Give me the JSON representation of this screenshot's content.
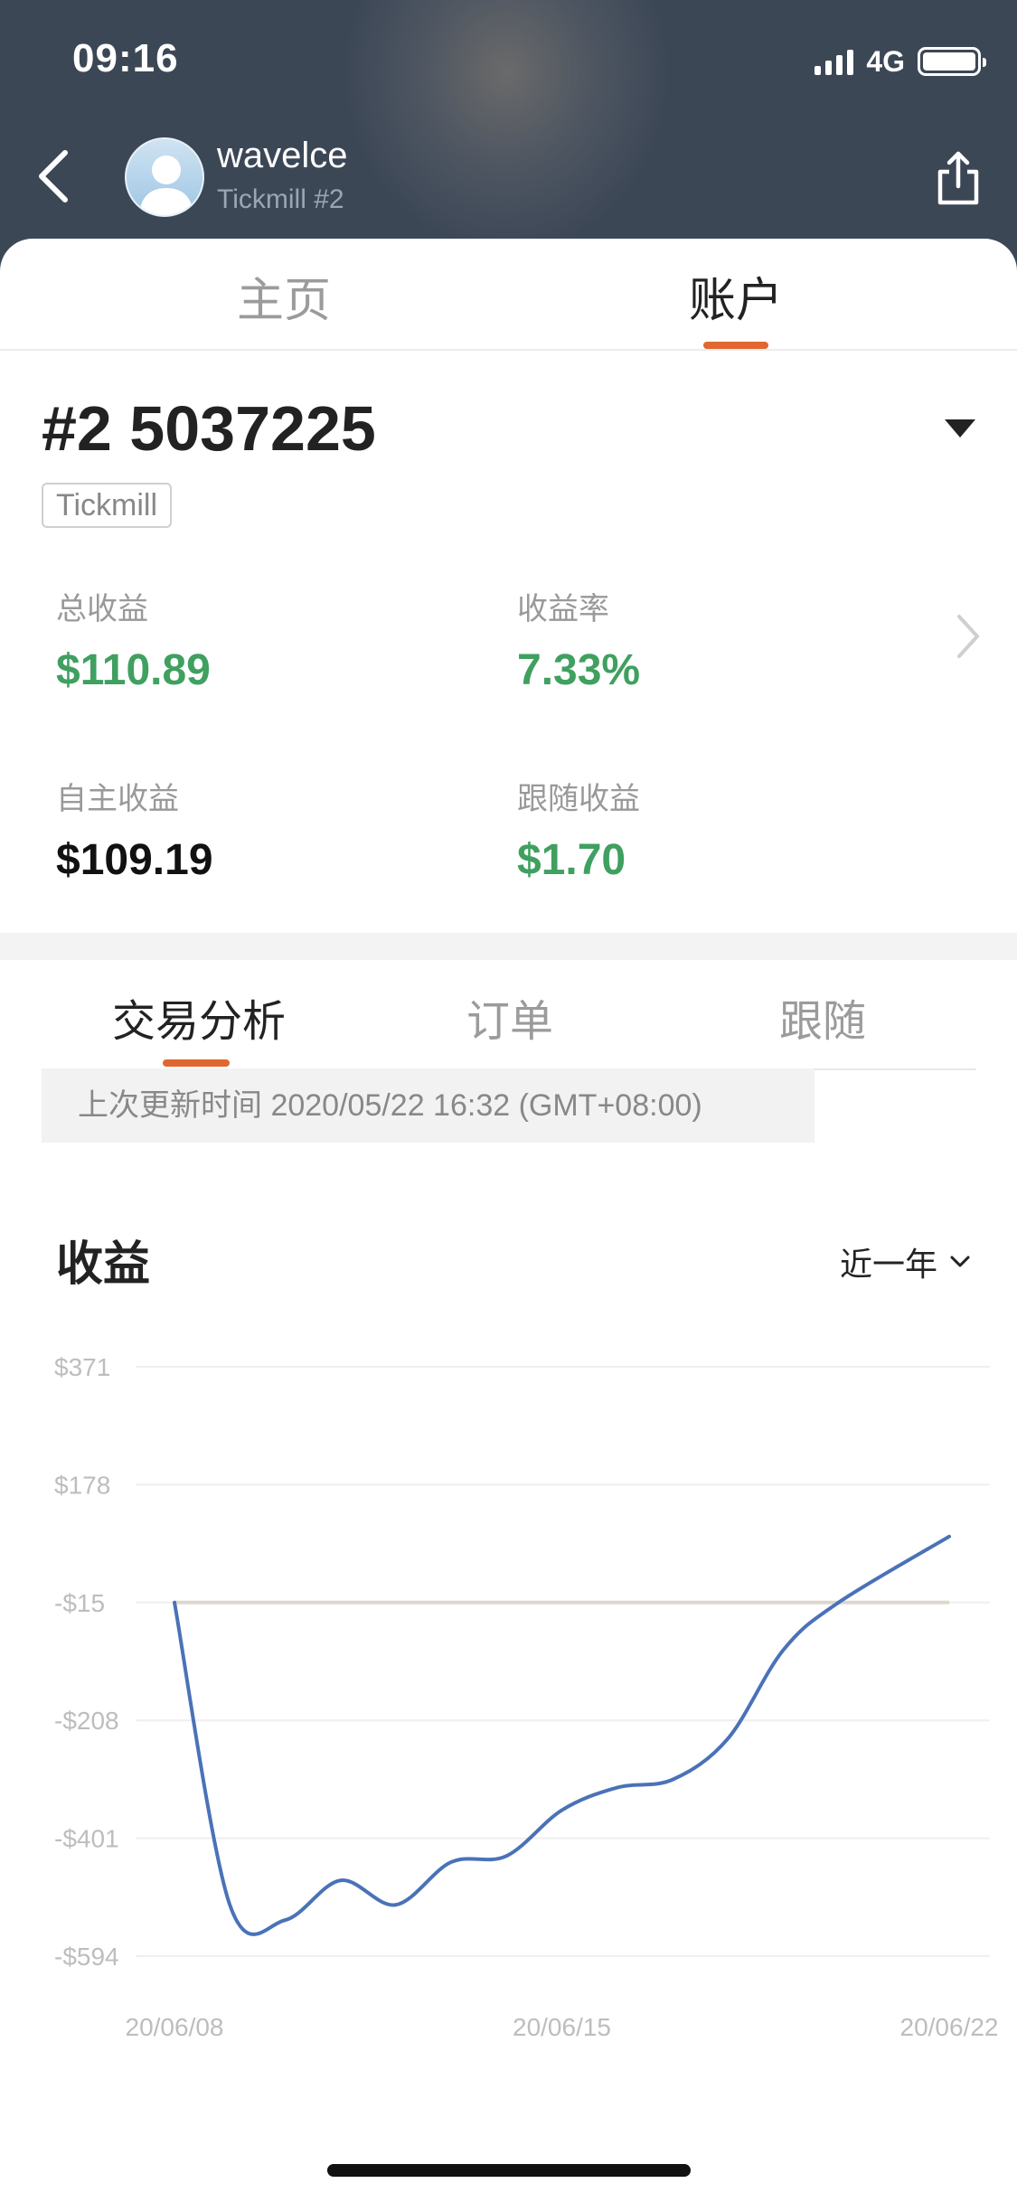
{
  "status_bar": {
    "time": "09:16",
    "network": "4G",
    "battery_level": 1.0
  },
  "header": {
    "back_icon": "chevron-left-icon",
    "user_name": "wavelce",
    "user_subtitle": "Tickmill #2",
    "share_icon": "share-icon"
  },
  "top_tabs": [
    {
      "label": "主页",
      "active": false
    },
    {
      "label": "账户",
      "active": true
    }
  ],
  "account": {
    "title": "#2 5037225",
    "broker": "Tickmill"
  },
  "stats": {
    "total_profit": {
      "label": "总收益",
      "value": "$110.89"
    },
    "return_rate": {
      "label": "收益率",
      "value": "7.33%"
    },
    "self_profit": {
      "label": "自主收益",
      "value": "$109.19"
    },
    "follow_profit": {
      "label": "跟随收益",
      "value": "$1.70"
    }
  },
  "sub_tabs": [
    {
      "label": "交易分析",
      "active": true
    },
    {
      "label": "订单",
      "active": false
    },
    {
      "label": "跟随",
      "active": false
    }
  ],
  "update_text": "上次更新时间 2020/05/22 16:32 (GMT+08:00)",
  "profit_section": {
    "title": "收益",
    "range_label": "近一年"
  },
  "colors": {
    "accent": "#e0672f",
    "positive": "#3fa060",
    "line": "#4a72b8",
    "baseline": "#ddd8cc"
  },
  "chart_data": {
    "type": "line",
    "y_ticks": [
      "$371",
      "$178",
      "-$15",
      "-$208",
      "-$401",
      "-$594"
    ],
    "x_ticks": [
      "20/06/08",
      "20/06/15",
      "20/06/22"
    ],
    "ylim": [
      -594,
      371
    ],
    "baseline_value": -15,
    "grid": true,
    "series": [
      {
        "values": [
          {
            "x": "2020-06-08",
            "y": -15
          },
          {
            "x": "2020-06-09",
            "y": -510
          },
          {
            "x": "2020-06-10",
            "y": -535
          },
          {
            "x": "2020-06-11",
            "y": -470
          },
          {
            "x": "2020-06-12",
            "y": -510
          },
          {
            "x": "2020-06-13",
            "y": -440
          },
          {
            "x": "2020-06-14",
            "y": -430
          },
          {
            "x": "2020-06-15",
            "y": -355
          },
          {
            "x": "2020-06-16",
            "y": -318
          },
          {
            "x": "2020-06-17",
            "y": -305
          },
          {
            "x": "2020-06-18",
            "y": -238
          },
          {
            "x": "2020-06-19",
            "y": -93
          },
          {
            "x": "2020-06-20",
            "y": -15
          },
          {
            "x": "2020-06-22",
            "y": 93
          }
        ]
      }
    ]
  }
}
